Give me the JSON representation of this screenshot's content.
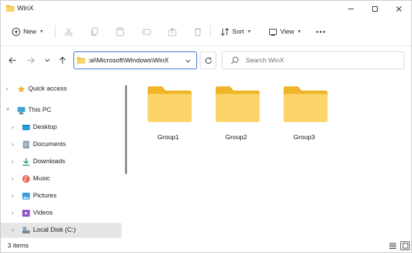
{
  "window": {
    "title": "WinX",
    "folder_color": "#f6c94b"
  },
  "toolbar": {
    "new_label": "New",
    "sort_label": "Sort",
    "view_label": "View",
    "icons": [
      "cut-icon",
      "copy-icon",
      "paste-icon",
      "rename-icon",
      "share-icon",
      "delete-icon"
    ]
  },
  "address": {
    "path": ":al\\Microsoft\\Windows\\WinX",
    "search_placeholder": "Search WinX",
    "accent": "#2f6ec9"
  },
  "nav": {
    "items": [
      {
        "label": "Quick access",
        "icon": "star-icon"
      },
      {
        "label": "This PC",
        "icon": "pc-icon"
      },
      {
        "label": "Desktop",
        "icon": "desktop-icon"
      },
      {
        "label": "Documents",
        "icon": "documents-icon"
      },
      {
        "label": "Downloads",
        "icon": "downloads-icon"
      },
      {
        "label": "Music",
        "icon": "music-icon"
      },
      {
        "label": "Pictures",
        "icon": "pictures-icon"
      },
      {
        "label": "Videos",
        "icon": "videos-icon"
      },
      {
        "label": "Local Disk (C:)",
        "icon": "disk-icon"
      }
    ]
  },
  "content": {
    "folders": [
      {
        "name": "Group1"
      },
      {
        "name": "Group2"
      },
      {
        "name": "Group3"
      }
    ]
  },
  "status": {
    "item_count": "3 items"
  }
}
